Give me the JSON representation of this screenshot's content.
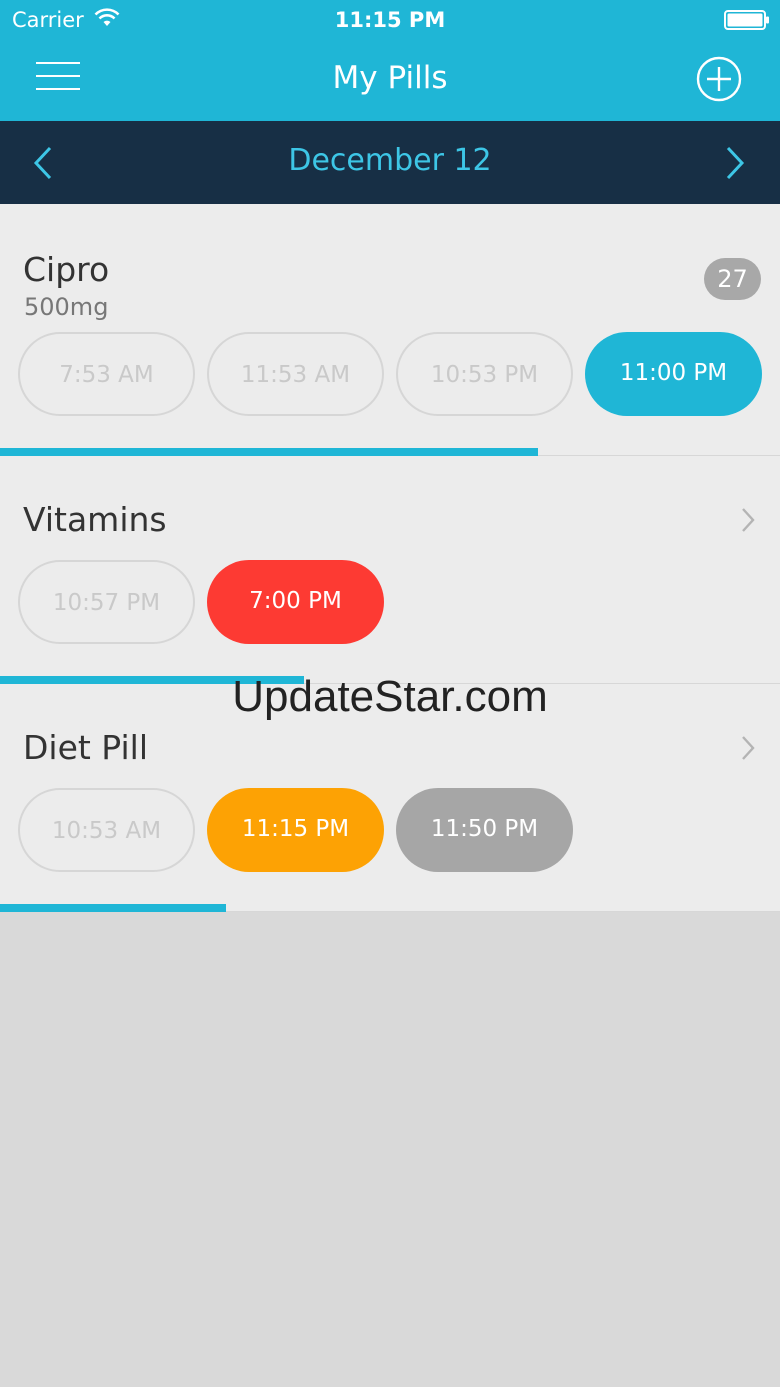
{
  "status_bar": {
    "carrier": "Carrier",
    "time": "11:15 PM"
  },
  "nav": {
    "title": "My Pills",
    "menu_icon": "hamburger-menu-icon",
    "add_icon": "plus-circle-icon"
  },
  "date_bar": {
    "date": "December 12",
    "prev_icon": "chevron-left-icon",
    "next_icon": "chevron-right-icon"
  },
  "pills": [
    {
      "name": "Cipro",
      "dose": "500mg",
      "badge": "27",
      "times": [
        {
          "label": "7:53 AM",
          "state": "taken"
        },
        {
          "label": "11:53 AM",
          "state": "taken"
        },
        {
          "label": "10:53 PM",
          "state": "taken"
        },
        {
          "label": "11:00 PM",
          "state": "current"
        }
      ],
      "progress": 0.69
    },
    {
      "name": "Vitamins",
      "times": [
        {
          "label": "10:57 PM",
          "state": "taken"
        },
        {
          "label": "7:00 PM",
          "state": "missed"
        }
      ],
      "progress": 0.39
    },
    {
      "name": "Diet Pill",
      "times": [
        {
          "label": "10:53 AM",
          "state": "taken"
        },
        {
          "label": "11:15 PM",
          "state": "due-now"
        },
        {
          "label": "11:50 PM",
          "state": "upcoming"
        }
      ],
      "progress": 0.29
    }
  ],
  "watermark": "UpdateStar.com",
  "colors": {
    "accent": "#1fb6d6",
    "date_bar_bg": "#172f45",
    "date_text": "#3dc6e6",
    "missed": "#fd3a33",
    "due": "#fda204",
    "upcoming": "#a6a6a6"
  }
}
